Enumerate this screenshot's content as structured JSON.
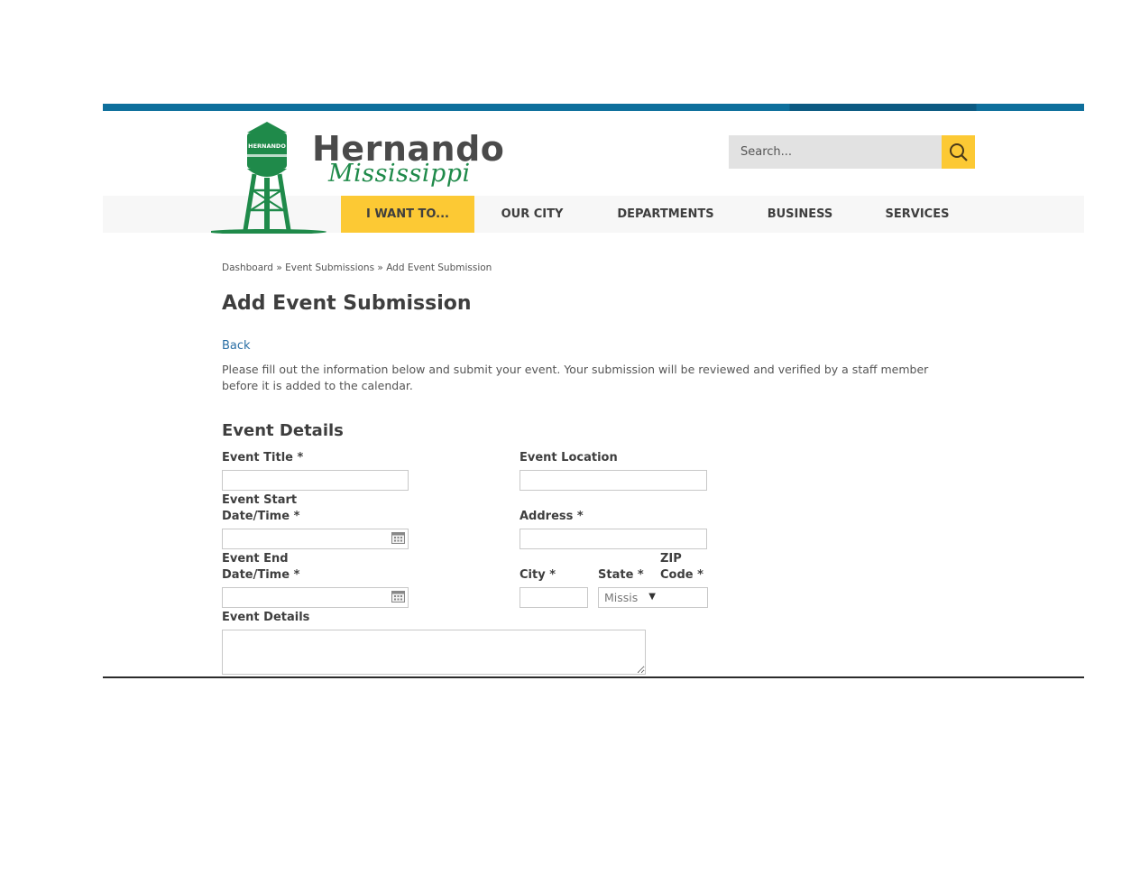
{
  "site": {
    "name": "Hernando",
    "subtitle": "Mississippi",
    "tower_label": "HERNANDO",
    "brand_green": "#1f8a4a",
    "accent_yellow": "#fcc934",
    "top_bar_blue": "#0e6f9c"
  },
  "search": {
    "placeholder": "Search...",
    "button_icon": "search-icon"
  },
  "nav": {
    "items": [
      {
        "label": "I WANT TO...",
        "active": true
      },
      {
        "label": "OUR CITY",
        "active": false
      },
      {
        "label": "DEPARTMENTS",
        "active": false
      },
      {
        "label": "BUSINESS",
        "active": false
      },
      {
        "label": "SERVICES",
        "active": false
      }
    ]
  },
  "breadcrumb": {
    "items": [
      "Dashboard",
      "Event Submissions",
      "Add Event Submission"
    ],
    "separator": "»"
  },
  "page": {
    "title": "Add Event Submission",
    "back_label": "Back",
    "intro": "Please fill out the information below and submit your event. Your submission will be reviewed and verified by a staff member before it is added to the calendar."
  },
  "form": {
    "section_title": "Event Details",
    "fields": {
      "event_title": {
        "label": "Event Title",
        "required": "*",
        "value": ""
      },
      "event_start_line1": "Event Start",
      "event_start_line2": "Date/Time",
      "event_start": {
        "required": "*",
        "value": "",
        "icon": "calendar-icon"
      },
      "event_end_line1": "Event End",
      "event_end_line2": "Date/Time",
      "event_end": {
        "required": "*",
        "value": "",
        "icon": "calendar-icon"
      },
      "event_details": {
        "label": "Event Details",
        "value": ""
      },
      "event_location": {
        "label": "Event Location",
        "value": ""
      },
      "address": {
        "label": "Address",
        "required": "*",
        "value": ""
      },
      "city": {
        "label": "City",
        "required": "*",
        "value": ""
      },
      "state": {
        "label": "State",
        "required": "*",
        "selected": "Missis"
      },
      "zip_line1": "ZIP",
      "zip_line2": "Code",
      "zip": {
        "required": "*",
        "value": ""
      }
    }
  }
}
